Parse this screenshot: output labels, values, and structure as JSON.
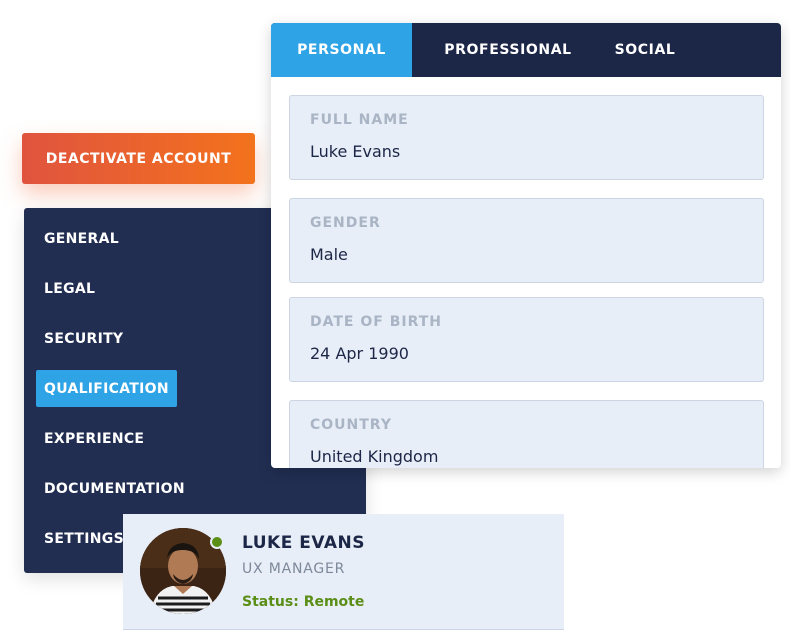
{
  "deactivate_button": {
    "label": "DEACTIVATE ACCOUNT"
  },
  "sidebar": {
    "items": [
      {
        "label": "GENERAL"
      },
      {
        "label": "LEGAL"
      },
      {
        "label": "SECURITY"
      },
      {
        "label": "QUALIFICATION",
        "active": true
      },
      {
        "label": "EXPERIENCE"
      },
      {
        "label": "DOCUMENTATION"
      },
      {
        "label": "SETTINGS"
      }
    ]
  },
  "card": {
    "tabs": [
      {
        "label": "PERSONAL",
        "active": true
      },
      {
        "label": "PROFESSIONAL"
      },
      {
        "label": "SOCIAL"
      }
    ],
    "fields": [
      {
        "label": "FULL NAME",
        "value": "Luke Evans"
      },
      {
        "label": "GENDER",
        "value": "Male"
      },
      {
        "label": "DATE OF BIRTH",
        "value": "24 Apr 1990"
      },
      {
        "label": "COUNTRY",
        "value": "United Kingdom"
      }
    ]
  },
  "profile": {
    "name": "LUKE EVANS",
    "role": "UX MANAGER",
    "status": "Status: Remote",
    "avatar_icon": "user-photo"
  },
  "colors": {
    "accent_blue": "#2ea3e6",
    "navy": "#212e52",
    "tab_bar": "#1c2647",
    "deactivate_start": "#e0543f",
    "deactivate_end": "#f3721c",
    "status_green": "#5a8e16",
    "field_bg": "#e8eef7"
  }
}
